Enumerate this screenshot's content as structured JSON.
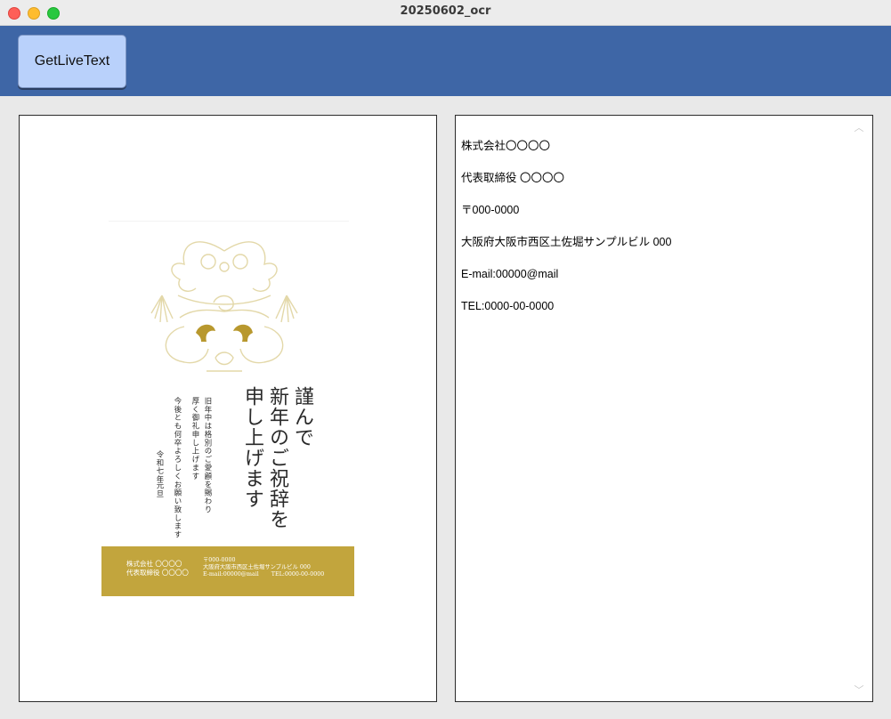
{
  "window": {
    "title": "20250602_ocr"
  },
  "toolbar": {
    "button_label": "GetLiveText"
  },
  "ocr": {
    "lines": [
      "株式会社〇〇〇〇",
      "代表取締役 〇〇〇〇",
      "〒000-0000",
      "大阪府大阪市西区土佐堀サンプルビル 000",
      "E-mail:00000@mail",
      "TEL:0000-00-0000"
    ]
  },
  "card": {
    "title_lines": [
      "謹んで",
      "新年のご祝辞を",
      "申し上げます"
    ],
    "body_lines": [
      "旧年中は格別のご愛顧を賜わり",
      "厚く御礼申し上げます",
      "今後とも何卒よろしくお願い致します",
      "令和七年",
      "元旦"
    ],
    "band": {
      "company": "株式会社 〇〇〇〇",
      "ceo": "代表取締役 〇〇〇〇",
      "postal": "〒000-0000",
      "address": "大阪府大阪市西区土佐堀サンプルビル 000",
      "email": "E-mail:00000@mail",
      "tel": "TEL:0000-00-0000"
    }
  },
  "colors": {
    "toolbar": "#3e66a6",
    "button": "#b9d1fb",
    "gold": "#c2a53d"
  },
  "icons": {
    "scroll_up": "chevron-up-icon",
    "scroll_down": "chevron-down-icon"
  }
}
